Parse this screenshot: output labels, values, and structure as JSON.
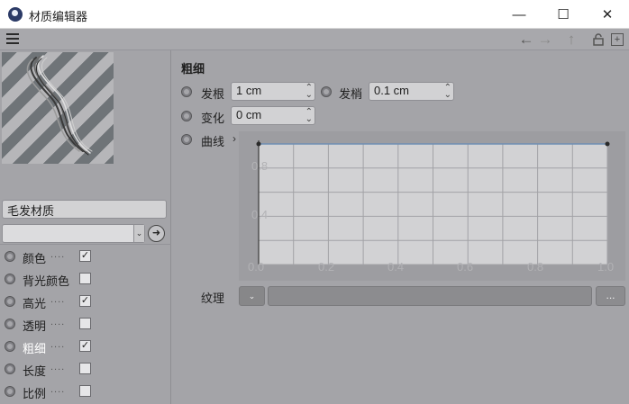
{
  "window": {
    "title": "材质编辑器",
    "minimize_glyph": "—",
    "maximize_glyph": "☐",
    "close_glyph": "✕"
  },
  "toolbar": {
    "icons": [
      "menu-icon",
      "arrow-left-icon",
      "arrow-right-icon",
      "arrow-up-icon",
      "lock-icon",
      "new-window-icon"
    ],
    "back_glyph": "←",
    "forward_glyph": "→",
    "up_glyph": "↑",
    "lock_glyph": "🔓",
    "new_glyph": "+"
  },
  "material": {
    "name": "毛发材质",
    "preset_value": "",
    "pick_glyph": "➜",
    "preset_arrow": "⌄"
  },
  "channels": [
    {
      "label": "颜色",
      "dots": "....",
      "checked": true,
      "active": false
    },
    {
      "label": "背光颜色",
      "dots": "",
      "checked": false,
      "active": false
    },
    {
      "label": "高光",
      "dots": "....",
      "checked": true,
      "active": false
    },
    {
      "label": "透明",
      "dots": "....",
      "checked": false,
      "active": false
    },
    {
      "label": "粗细",
      "dots": "....",
      "checked": true,
      "active": true
    },
    {
      "label": "长度",
      "dots": "....",
      "checked": false,
      "active": false
    },
    {
      "label": "比例",
      "dots": "....",
      "checked": false,
      "active": false
    }
  ],
  "check_glyph": "✓",
  "section": {
    "title": "粗细",
    "root_label": "发根",
    "root_value": "1 cm",
    "tip_label": "发梢",
    "tip_value": "0.1 cm",
    "variation_label": "变化",
    "variation_value": "0 cm",
    "curve_label": "曲线",
    "curve_arrow": "›",
    "spin_glyph": "⌃⌄"
  },
  "chart_data": {
    "type": "line",
    "x": [
      0.0,
      1.0
    ],
    "y": [
      1.0,
      1.0
    ],
    "xlim": [
      0.0,
      1.0
    ],
    "ylim": [
      0.0,
      1.0
    ],
    "x_ticks": [
      "0.0",
      "0.2",
      "0.4",
      "0.6",
      "0.8",
      "1.0"
    ],
    "y_ticks": [
      "0.8",
      "0.4"
    ],
    "grid": true
  },
  "texture": {
    "label": "纹理",
    "dropdown_glyph": "⌄",
    "value": "",
    "more_label": "..."
  }
}
